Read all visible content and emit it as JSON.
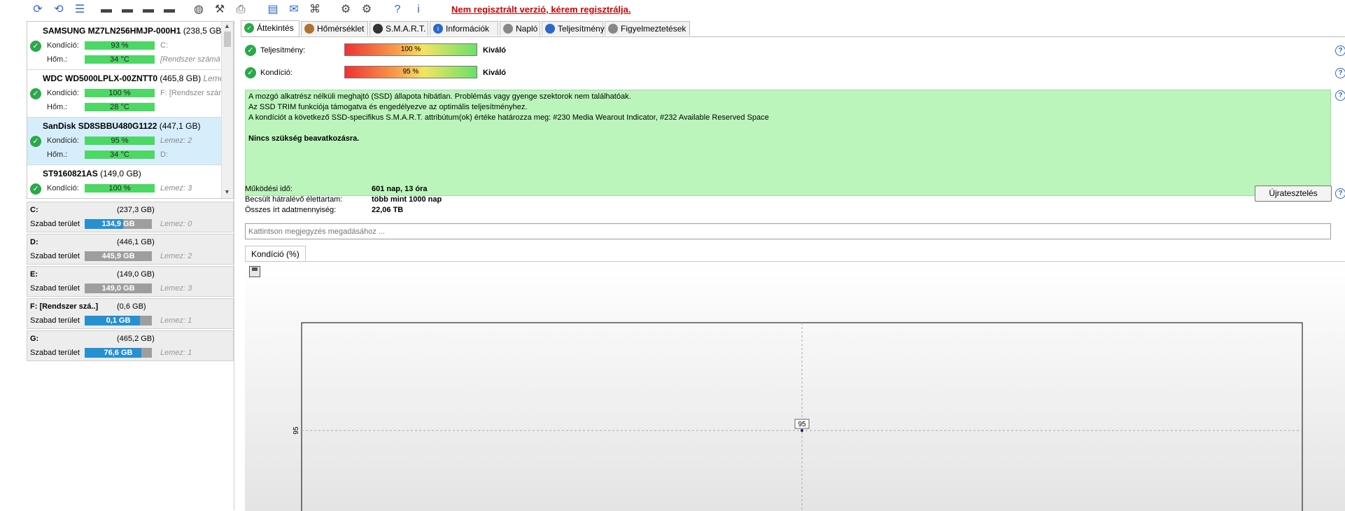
{
  "toolbar": {
    "icons": [
      "refresh-icon",
      "refresh-all-icon",
      "menu-icon",
      "disk-settings-icon",
      "disk-temperature-icon",
      "disk-health-icon",
      "disk-search-icon",
      "hdd-icon",
      "tools-icon",
      "print-icon",
      "document-icon",
      "mail-icon",
      "network-icon",
      "gear-icon",
      "options-icon",
      "help-icon",
      "info-icon"
    ],
    "register_link": "Nem regisztrált verzió, kérem regisztrálja."
  },
  "disks": [
    {
      "model": "SAMSUNG MZ7LN256HMJP-000H1",
      "capacity": "(238,5 GB)",
      "kondicio_label": "Kondíció:",
      "kondicio": "93 %",
      "kondicio_pct": 93,
      "hom_label": "Hőm.:",
      "hom": "34 °C",
      "meta1": "C:",
      "meta2": "[Rendszer számá"
    },
    {
      "model": "WDC WD5000LPLX-00ZNTT0",
      "capacity": "(465,8 GB)",
      "meta0": "Lemez",
      "kondicio_label": "Kondíció:",
      "kondicio": "100 %",
      "kondicio_pct": 100,
      "hom_label": "Hőm.:",
      "hom": "28 °C",
      "meta1": "F: [Rendszer szám"
    },
    {
      "model": "SanDisk SD8SBBU480G1122",
      "capacity": "(447,1 GB)",
      "kondicio_label": "Kondíció:",
      "kondicio": "95 %",
      "kondicio_pct": 95,
      "hom_label": "Hőm.:",
      "hom": "34 °C",
      "meta1": "Lemez: 2",
      "meta2": "D:"
    },
    {
      "model": "ST9160821AS",
      "capacity": "(149,0 GB)",
      "kondicio_label": "Kondíció:",
      "kondicio": "100 %",
      "kondicio_pct": 100,
      "meta1": "Lemez: 3"
    }
  ],
  "volumes": [
    {
      "name": "C:",
      "capacity": "(237,3 GB)",
      "free_label": "Szabad terület",
      "free": "134,9 GB",
      "free_frac": 0.57,
      "disk": "Lemez: 0"
    },
    {
      "name": "D:",
      "capacity": "(446,1 GB)",
      "free_label": "Szabad terület",
      "free": "445,9 GB",
      "free_frac": 0.0,
      "disk": "Lemez: 2"
    },
    {
      "name": "E:",
      "capacity": "(149,0 GB)",
      "free_label": "Szabad terület",
      "free": "149,0 GB",
      "free_frac": 0.0,
      "disk": "Lemez: 3"
    },
    {
      "name": "F: [Rendszer szá..]",
      "capacity": "(0,6 GB)",
      "free_label": "Szabad terület",
      "free": "0,1 GB",
      "free_frac": 0.82,
      "disk": "Lemez: 1"
    },
    {
      "name": "G:",
      "capacity": "(465,2 GB)",
      "free_label": "Szabad terület",
      "free": "76,6 GB",
      "free_frac": 0.84,
      "disk": "Lemez: 1"
    }
  ],
  "tabs": [
    {
      "label": "Áttekintés",
      "icon": "check-icon"
    },
    {
      "label": "Hőmérséklet",
      "icon": "thermometer-icon"
    },
    {
      "label": "S.M.A.R.T.",
      "icon": "disk-icon"
    },
    {
      "label": "Információk",
      "icon": "info-icon"
    },
    {
      "label": "Napló",
      "icon": "log-icon"
    },
    {
      "label": "Teljesítmény",
      "icon": "performance-icon"
    },
    {
      "label": "Figyelmeztetések",
      "icon": "warnings-icon"
    }
  ],
  "overview": {
    "perf_label": "Teljesítmény:",
    "perf_value": "100 %",
    "perf_grade": "Kiváló",
    "cond_label": "Kondíció:",
    "cond_value": "95 %",
    "cond_grade": "Kiváló",
    "status_lines": [
      "A mozgó alkatrész nélküli meghajtó (SSD) állapota hibátlan. Problémás vagy gyenge szektorok nem találhatóak.",
      "Az SSD TRIM funkciója támogatva és engedélyezve az optimális teljesítményhez.",
      "A kondíciót a következő SSD-specifikus S.M.A.R.T. attribútum(ok) értéke határozza meg:  #230 Media Wearout Indicator, #232 Available Reserved Space"
    ],
    "status_strong": "Nincs szükség beavatkozásra.",
    "stats": [
      {
        "label": "Működési idő:",
        "value": "601 nap, 13 óra"
      },
      {
        "label": "Becsült hátralévő élettartam:",
        "value": "több mint 1000 nap"
      },
      {
        "label": "Összes írt adatmennyiség:",
        "value": "22,06 TB"
      }
    ],
    "retest_button": "Újratesztelés",
    "note_placeholder": "Kattintson megjegyzés megadásához ..."
  },
  "chart_tab": "Kondíció  (%)",
  "chart_data": {
    "type": "line",
    "series": [
      {
        "values": [
          95
        ]
      }
    ],
    "y_ticks": [
      95
    ],
    "point_label": "95",
    "grid": true
  }
}
